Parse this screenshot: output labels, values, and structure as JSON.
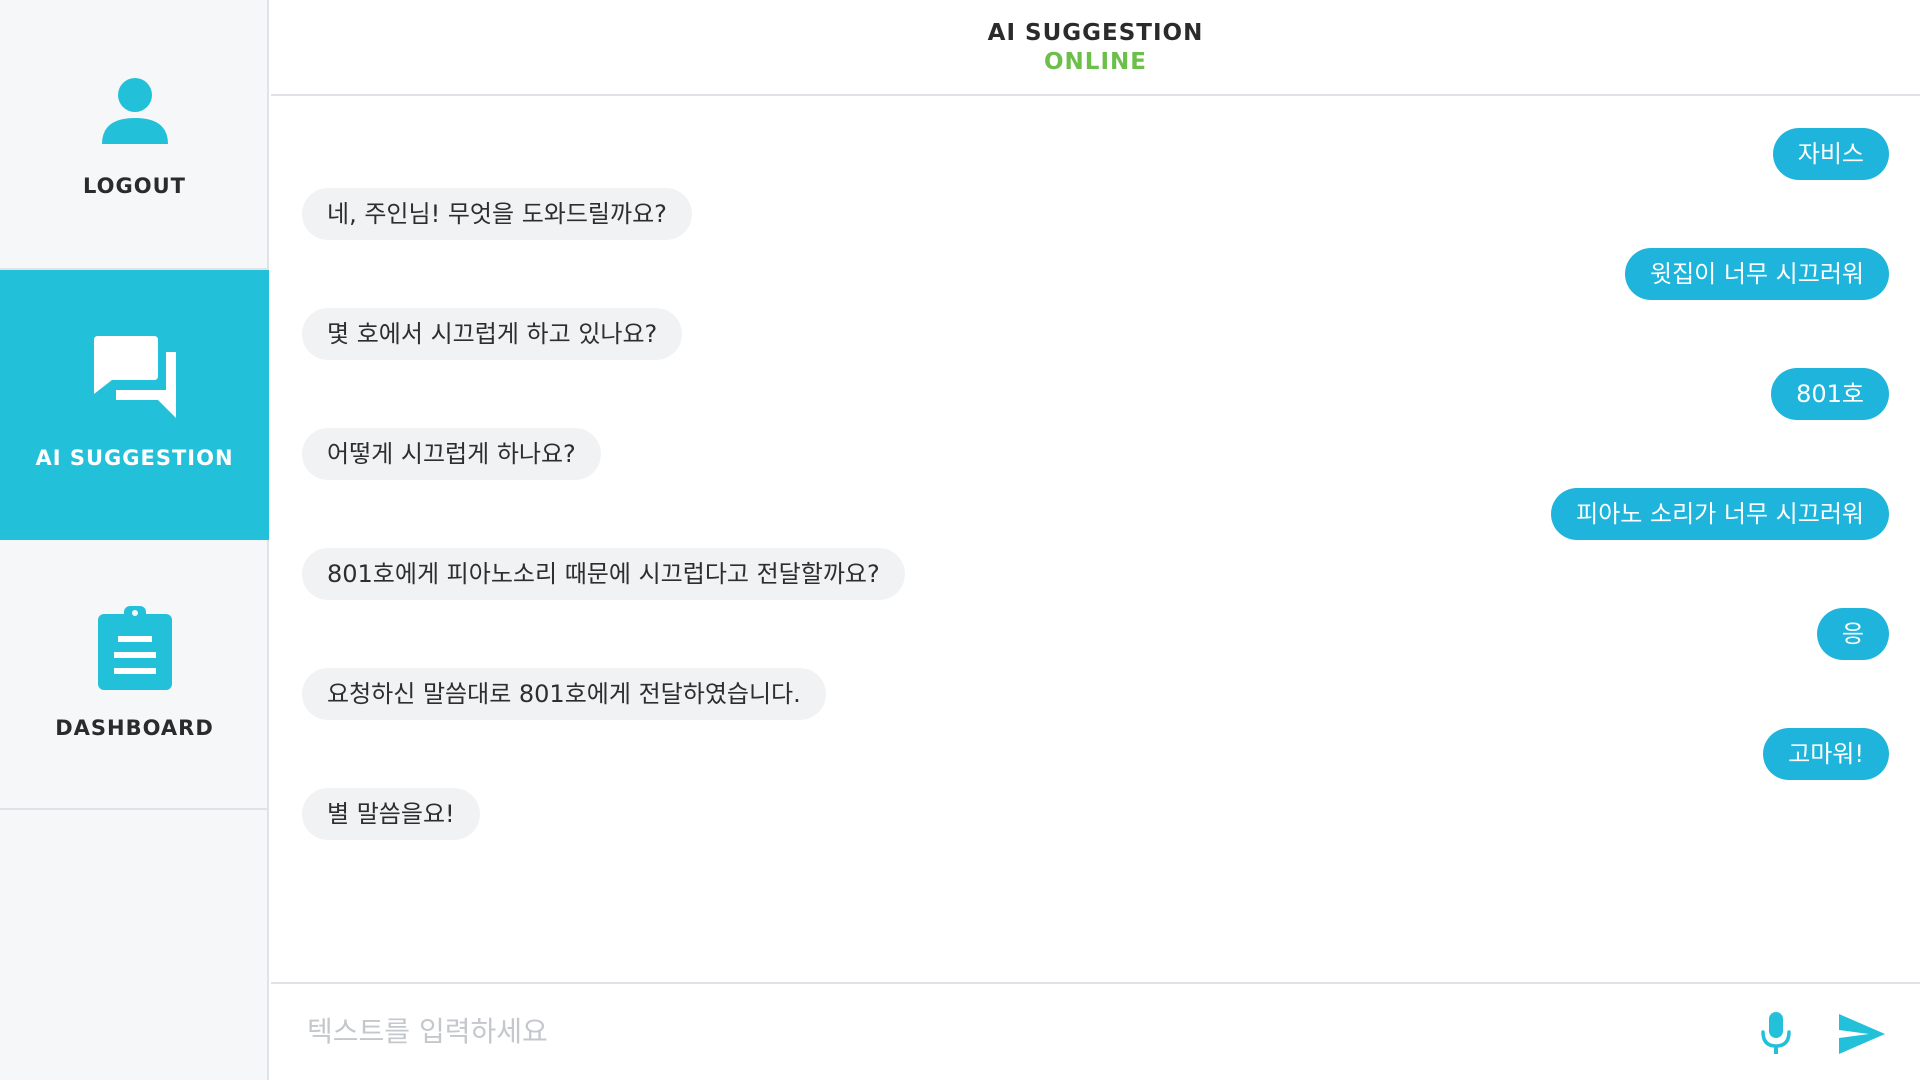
{
  "sidebar": {
    "items": [
      {
        "label": "LOGOUT",
        "icon": "user-icon"
      },
      {
        "label": "AI SUGGESTION",
        "icon": "chat-bubbles-icon",
        "active": true
      },
      {
        "label": "DASHBOARD",
        "icon": "clipboard-icon"
      }
    ]
  },
  "header": {
    "title": "AI SUGGESTION",
    "status": "ONLINE"
  },
  "messages": [
    {
      "sender": "user",
      "text": "자비스"
    },
    {
      "sender": "ai",
      "text": "네, 주인님! 무엇을 도와드릴까요?"
    },
    {
      "sender": "user",
      "text": "윗집이 너무 시끄러워"
    },
    {
      "sender": "ai",
      "text": "몇 호에서 시끄럽게 하고 있나요?"
    },
    {
      "sender": "user",
      "text": "801호"
    },
    {
      "sender": "ai",
      "text": "어떻게 시끄럽게 하나요?"
    },
    {
      "sender": "user",
      "text": "피아노 소리가 너무 시끄러워"
    },
    {
      "sender": "ai",
      "text": "801호에게 피아노소리 때문에 시끄럽다고 전달할까요?"
    },
    {
      "sender": "user",
      "text": "응"
    },
    {
      "sender": "ai",
      "text": "요청하신 말씀대로 801호에게 전달하였습니다."
    },
    {
      "sender": "user",
      "text": "고마워!"
    },
    {
      "sender": "ai",
      "text": "별 말씀을요!"
    }
  ],
  "input": {
    "placeholder": "텍스트를 입력하세요",
    "value": ""
  },
  "colors": {
    "accent": "#22c1d9",
    "user_bubble": "#1fb4dc",
    "ai_bubble": "#f1f2f4",
    "online": "#6cc04a"
  }
}
